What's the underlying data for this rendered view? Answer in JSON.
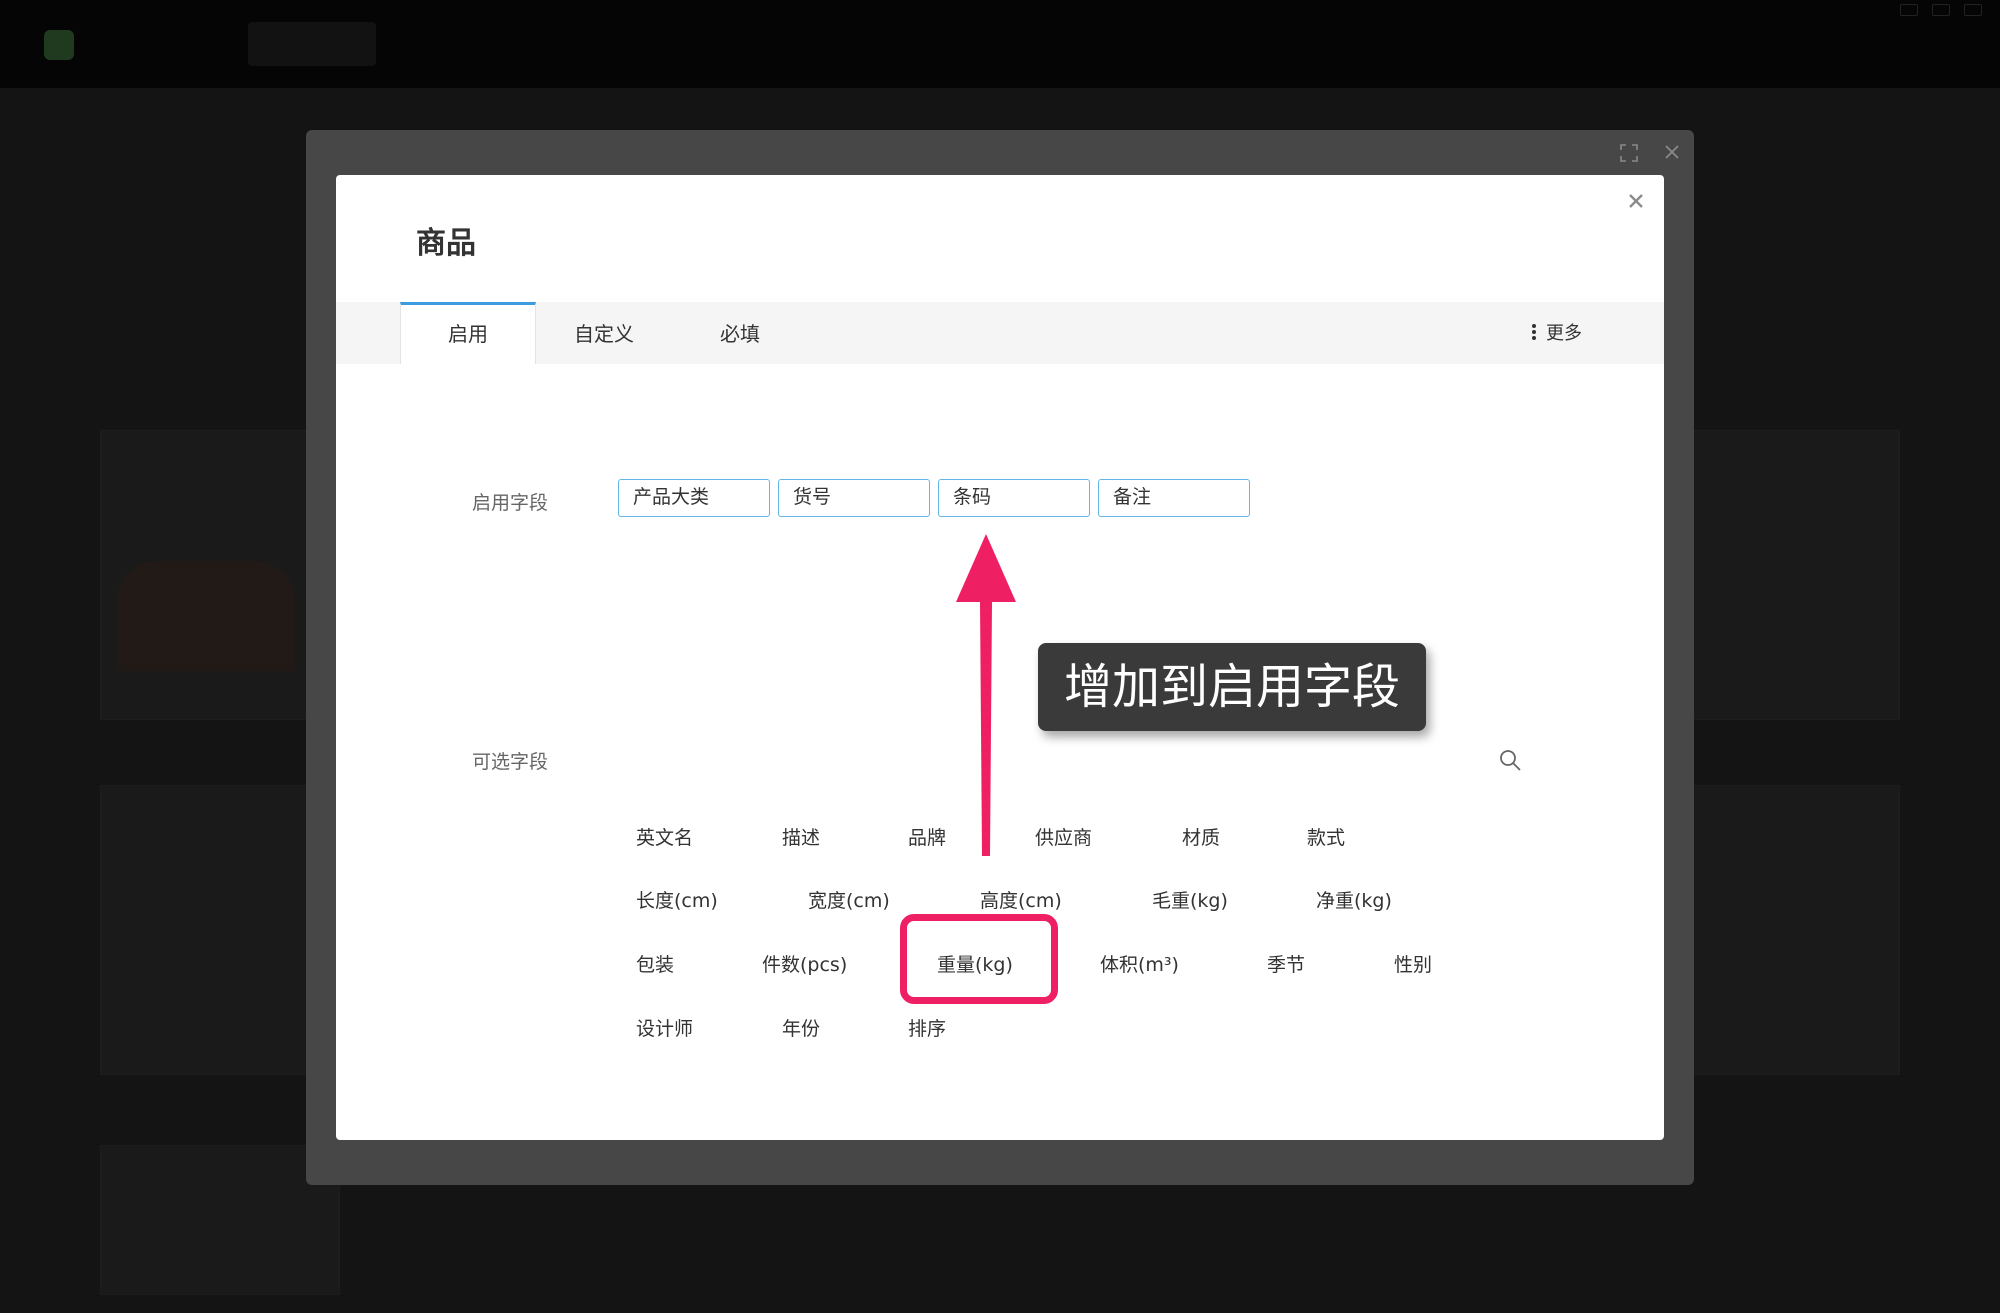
{
  "modal": {
    "title": "商品",
    "tabs": [
      {
        "label": "启用",
        "active": true
      },
      {
        "label": "自定义",
        "active": false
      },
      {
        "label": "必填",
        "active": false
      }
    ],
    "more_label": "更多",
    "enabled_fields_label": "启用字段",
    "enabled_fields": [
      "产品大类",
      "货号",
      "条码",
      "备注"
    ],
    "optional_fields_label": "可选字段",
    "optional_fields": [
      [
        "英文名",
        "描述",
        "品牌",
        "供应商",
        "材质",
        "款式"
      ],
      [
        "长度(cm)",
        "宽度(cm)",
        "高度(cm)",
        "毛重(kg)",
        "净重(kg)"
      ],
      [
        "包装",
        "件数(pcs)",
        "重量(kg)",
        "体积(m³)",
        "季节",
        "性别"
      ],
      [
        "设计师",
        "年份",
        "排序"
      ]
    ]
  },
  "annotation": {
    "tooltip_text": "增加到启用字段",
    "highlighted_field": "重量(kg)",
    "accent_color": "#ef1f64"
  },
  "colors": {
    "tab_active_border": "#3d9bdf",
    "chip_border": "#63b7e6",
    "overlay": "#141414",
    "frame": "#474747"
  },
  "icons": [
    "search-icon",
    "close-icon",
    "expand-icon",
    "more-vertical-icon"
  ]
}
